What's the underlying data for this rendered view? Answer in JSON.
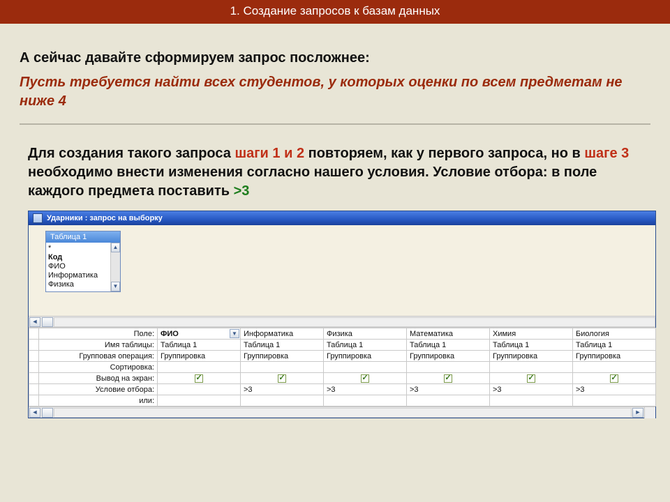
{
  "header": "1. Создание запросов к базам данных",
  "lead": "А сейчас давайте сформируем запрос посложнее:",
  "task": "Пусть требуется найти всех студентов, у которых оценки по всем предметам не ниже 4",
  "instr": {
    "p1a": "Для создания такого запроса ",
    "s12": "шаги 1 и 2",
    "p1b": " повторяем, как у первого запроса, но в ",
    "s3": "шаге 3",
    "p1c": " необходимо внести изменения согласно нашего условия. Условие отбора: в поле каждого предмета поставить ",
    "gt3": ">3"
  },
  "app": {
    "title": "Ударники : запрос на выборку",
    "tablebox_title": "Таблица 1",
    "fields": [
      "*",
      "Код",
      "ФИО",
      "Информатика",
      "Физика"
    ],
    "row_labels": [
      "Поле:",
      "Имя таблицы:",
      "Групповая операция:",
      "Сортировка:",
      "Вывод на экран:",
      "Условие отбора:",
      "или:"
    ],
    "columns": [
      {
        "field": "ФИО",
        "table": "Таблица 1",
        "group": "Группировка",
        "show": true,
        "crit": ""
      },
      {
        "field": "Информатика",
        "table": "Таблица 1",
        "group": "Группировка",
        "show": true,
        "crit": ">3"
      },
      {
        "field": "Физика",
        "table": "Таблица 1",
        "group": "Группировка",
        "show": true,
        "crit": ">3"
      },
      {
        "field": "Математика",
        "table": "Таблица 1",
        "group": "Группировка",
        "show": true,
        "crit": ">3"
      },
      {
        "field": "Химия",
        "table": "Таблица 1",
        "group": "Группировка",
        "show": true,
        "crit": ">3"
      },
      {
        "field": "Биология",
        "table": "Таблица 1",
        "group": "Группировка",
        "show": true,
        "crit": ">3"
      }
    ]
  }
}
